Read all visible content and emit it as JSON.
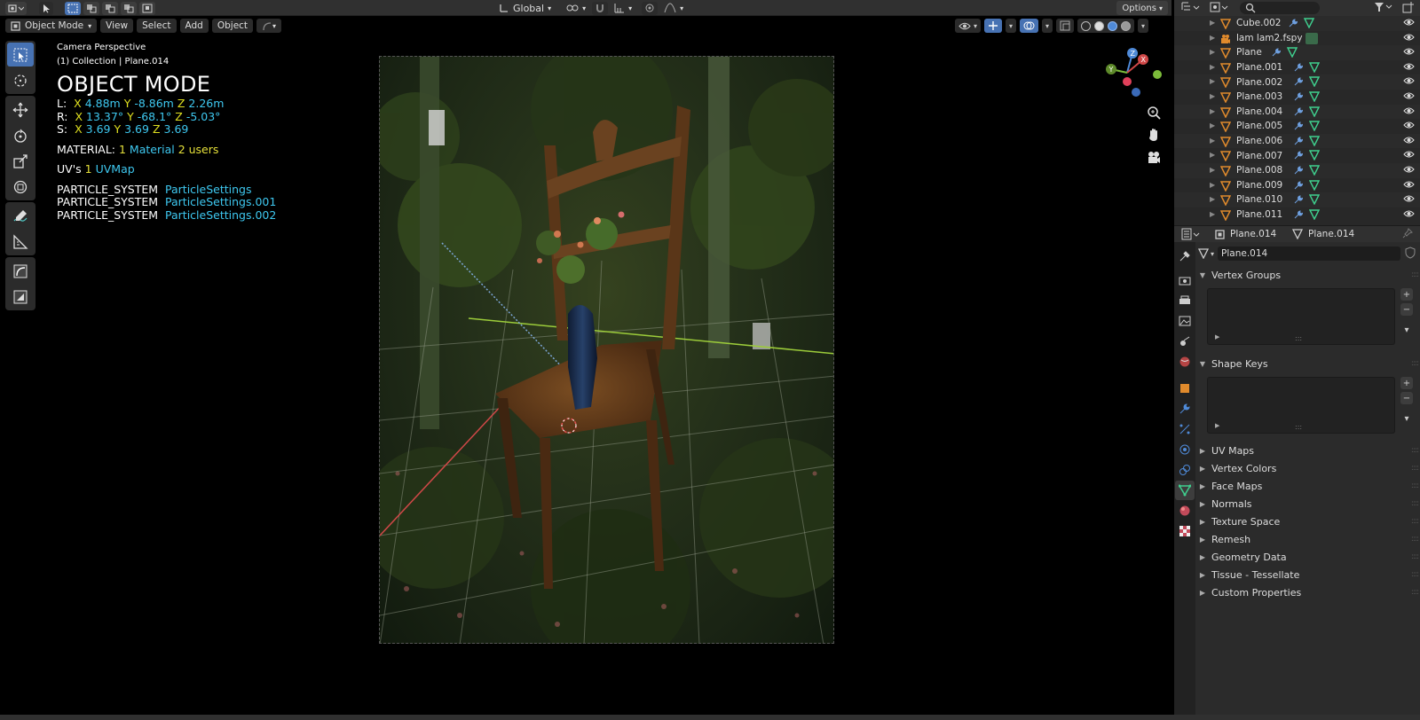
{
  "topbar": {
    "transform_orientation": "Global",
    "options_label": "Options"
  },
  "viewport_header": {
    "mode_label": "Object Mode",
    "menus": [
      "View",
      "Select",
      "Add",
      "Object"
    ]
  },
  "overlay": {
    "view_name": "Camera Perspective",
    "collection_info": "(1) Collection | Plane.014",
    "mode_title": "OBJECT MODE",
    "location": {
      "prefix": "L:",
      "x": "4.88m",
      "y": "-8.86m",
      "z": "2.26m"
    },
    "rotation": {
      "prefix": "R:",
      "x": "13.37°",
      "y": "-68.1°",
      "z": "-5.03°"
    },
    "scale": {
      "prefix": "S:",
      "x": "3.69",
      "y": "3.69",
      "z": "3.69"
    },
    "material": {
      "label": "MATERIAL:",
      "count": "1",
      "name": "Material",
      "users": "2 users"
    },
    "uvs": {
      "label": "UV's",
      "count": "1",
      "name": "UVMap"
    },
    "particles": [
      {
        "label": "PARTICLE_SYSTEM",
        "name": "ParticleSettings"
      },
      {
        "label": "PARTICLE_SYSTEM",
        "name": "ParticleSettings.001"
      },
      {
        "label": "PARTICLE_SYSTEM",
        "name": "ParticleSettings.002"
      }
    ]
  },
  "outliner": {
    "items": [
      {
        "name": "Cube.002",
        "type": "mesh"
      },
      {
        "name": "lam lam2.fspy",
        "type": "camera"
      },
      {
        "name": "Plane",
        "type": "mesh"
      },
      {
        "name": "Plane.001",
        "type": "mesh"
      },
      {
        "name": "Plane.002",
        "type": "mesh"
      },
      {
        "name": "Plane.003",
        "type": "mesh"
      },
      {
        "name": "Plane.004",
        "type": "mesh"
      },
      {
        "name": "Plane.005",
        "type": "mesh"
      },
      {
        "name": "Plane.006",
        "type": "mesh"
      },
      {
        "name": "Plane.007",
        "type": "mesh"
      },
      {
        "name": "Plane.008",
        "type": "mesh"
      },
      {
        "name": "Plane.009",
        "type": "mesh"
      },
      {
        "name": "Plane.010",
        "type": "mesh"
      },
      {
        "name": "Plane.011",
        "type": "mesh"
      }
    ]
  },
  "properties": {
    "object_name": "Plane.014",
    "mesh_name": "Plane.014",
    "data_field": "Plane.014",
    "panels_open": [
      "Vertex Groups",
      "Shape Keys"
    ],
    "panels_closed": [
      "UV Maps",
      "Vertex Colors",
      "Face Maps",
      "Normals",
      "Texture Space",
      "Remesh",
      "Geometry Data",
      "Tissue - Tessellate",
      "Custom Properties"
    ]
  },
  "colors": {
    "accent": "#4772b3",
    "value_cyan": "#3ec8f0",
    "axis_yellow": "#e0e020",
    "mesh_green": "#3fcf8e",
    "object_orange": "#e08a2c"
  }
}
